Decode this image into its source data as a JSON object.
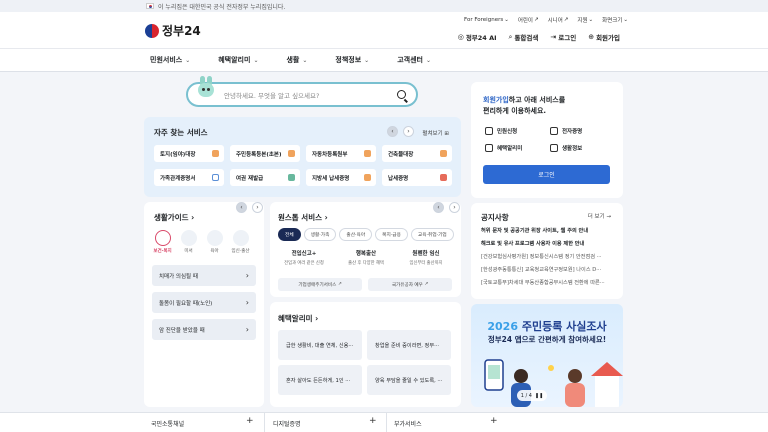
{
  "notice": {
    "text": "이 누리집은 대한민국 공식 전자정부 누리집입니다."
  },
  "header": {
    "logo_text": "정부24",
    "util_links": [
      "For Foreigners",
      "어린이",
      "시니어",
      "지원",
      "화면크기"
    ],
    "quick_links": [
      "정부24 AI",
      "통합검색",
      "로그인",
      "회원가입"
    ]
  },
  "nav": {
    "items": [
      "민원서비스",
      "혜택알리미",
      "생활",
      "정책정보",
      "고객센터"
    ]
  },
  "search": {
    "placeholder": "안녕하세요. 무엇을 알고 싶으세요?"
  },
  "frequent": {
    "title": "자주 찾는 서비스",
    "more": "펼쳐보기",
    "items": [
      "토지(임야)대장",
      "주민등록등본(초본)",
      "자동차등록원부",
      "건축물대장",
      "가족관계증명서",
      "여권 재발급",
      "지방세 납세증명",
      "납세증명"
    ]
  },
  "login": {
    "highlight": "회원가입",
    "msg1": "하고 아래 서비스를",
    "msg2": "편리하게 이용하세요.",
    "items": [
      "민원신청",
      "전자증명",
      "혜택알리미",
      "생활정보"
    ],
    "button": "로그인"
  },
  "life": {
    "title": "생활가이드",
    "icons": [
      "보건·복지",
      "미서",
      "육아",
      "임신·출산"
    ],
    "items": [
      "치매가 의심될 때",
      "돌봄이 필요할 때(노인)",
      "암 진단을 받았을 때"
    ]
  },
  "onestop": {
    "title": "원스톱 서비스",
    "tabs": [
      "전체",
      "생활·가족",
      "출산·육아",
      "복지·급용",
      "교육·취업·기업"
    ],
    "cols": [
      {
        "title": "전입신고+",
        "desc": "전입과 여러 같은 신청"
      },
      {
        "title": "행복출산",
        "desc": "출산 후 다양한 혜택"
      },
      {
        "title": "원펜한 임신",
        "desc": "임신부터 출산까지"
      }
    ],
    "links": [
      "기업생애주기서비스",
      "국가유공자 예우"
    ]
  },
  "benefit": {
    "title": "혜택알리미",
    "items": [
      "급한 생활비, 대출 연체, 신용···",
      "창업을 준비 중이라면, 정부···",
      "혼자 살아도 든든하게, 1인 ···",
      "양육 부담을 줄일 수 있도록, ···"
    ]
  },
  "noticebox": {
    "title": "공지사항",
    "more": "더 보기",
    "items": [
      "허위 문자 및 공공기관 위장 사이트, 웹 주의 안내",
      "해크로 및 유사 프로그램 사용자 이용 제한 안내",
      "[건강보험심사평가원] 정보통신시스템 정기 안전점검 ···",
      "[한성광주동통통신] 교육청교육연구정보원] 나이스 D···",
      "[국토교통부]차세대 부동산종합공부시스템 전환에 따른···"
    ]
  },
  "banner": {
    "title1_a": "2026",
    "title1_b": "주민등록 사실조사",
    "title2": "정부24 앱으로 간편하게 참여하세요!",
    "pager": "1 / 4"
  },
  "footer": {
    "cols": [
      "국민소통채널",
      "디지털증명",
      "부가서비스"
    ]
  },
  "colors": {
    "primary": "#2d6ad3",
    "accent_red": "#d94a6a"
  }
}
